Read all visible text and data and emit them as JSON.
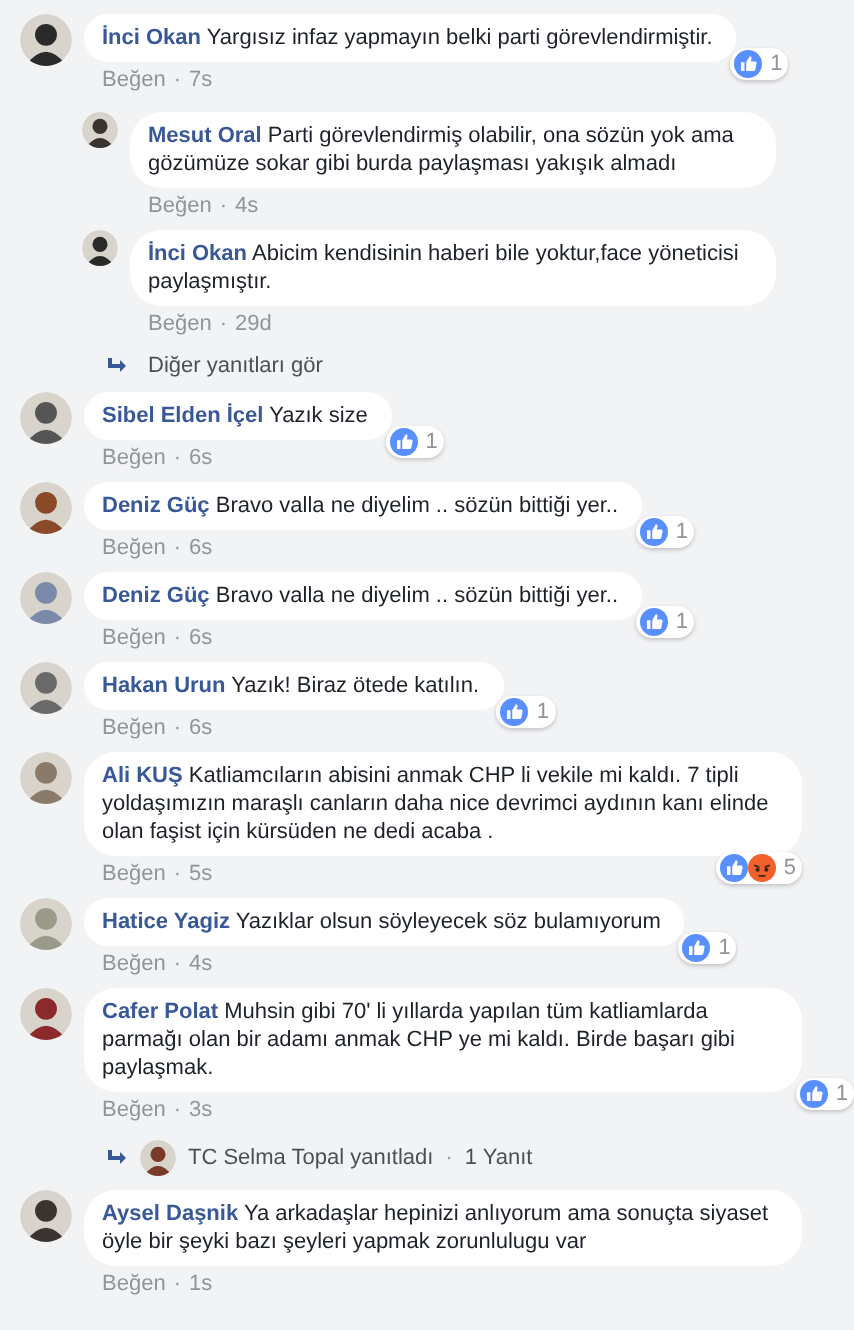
{
  "comments": [
    {
      "author": "İnci Okan",
      "text": "Yargısız infaz yapmayın belki parti görevlendirmiştir.",
      "like_label": "Beğen",
      "dot": "·",
      "time": "7s",
      "reactions": {
        "icons": [
          {
            "kind": "like"
          }
        ],
        "count": "1"
      },
      "replies": [
        {
          "author": "Mesut Oral",
          "text": "Parti görevlendirmiş olabilir, ona sözün yok ama gözümüze sokar gibi burda paylaşması yakışık almadı",
          "like_label": "Beğen",
          "dot": "·",
          "time": "4s"
        },
        {
          "author": "İnci Okan",
          "text": "Abicim kendisinin haberi bile yoktur,face yöneticisi paylaşmıştır.",
          "like_label": "Beğen",
          "dot": "·",
          "time": "29d"
        }
      ],
      "more_replies": "Diğer yanıtları gör"
    },
    {
      "author": "Sibel Elden İçel",
      "text": "Yazık size",
      "like_label": "Beğen",
      "dot": "·",
      "time": "6s",
      "reactions": {
        "icons": [
          {
            "kind": "like"
          }
        ],
        "count": "1"
      }
    },
    {
      "author": "Deniz Güç",
      "text": "Bravo valla ne diyelim .. sözün bittiği yer..",
      "like_label": "Beğen",
      "dot": "·",
      "time": "6s",
      "reactions": {
        "icons": [
          {
            "kind": "like"
          }
        ],
        "count": "1"
      }
    },
    {
      "author": "Deniz Güç",
      "text": "Bravo valla ne diyelim .. sözün bittiği yer..",
      "like_label": "Beğen",
      "dot": "·",
      "time": "6s",
      "reactions": {
        "icons": [
          {
            "kind": "like"
          }
        ],
        "count": "1"
      }
    },
    {
      "author": "Hakan Urun",
      "text": "Yazık! Biraz ötede katılın.",
      "like_label": "Beğen",
      "dot": "·",
      "time": "6s",
      "reactions": {
        "icons": [
          {
            "kind": "like"
          }
        ],
        "count": "1"
      }
    },
    {
      "author": "Ali KUŞ",
      "text": "Katliamcıların abisini anmak CHP li vekile mi kaldı. 7 tipli yoldaşımızın maraşlı canların daha nice devrimci aydının kanı elinde olan faşist için kürsüden ne dedi acaba .",
      "like_label": "Beğen",
      "dot": "·",
      "time": "5s",
      "reactions": {
        "icons": [
          {
            "kind": "like"
          },
          {
            "kind": "angry"
          }
        ],
        "count": "5"
      }
    },
    {
      "author": "Hatice Yagiz",
      "text": "Yazıklar olsun söyleyecek söz bulamıyorum",
      "like_label": "Beğen",
      "dot": "·",
      "time": "4s",
      "reactions": {
        "icons": [
          {
            "kind": "like"
          }
        ],
        "count": "1"
      }
    },
    {
      "author": "Cafer Polat",
      "text": "Muhsin gibi 70' li yıllarda yapılan tüm katliamlarda parmağı olan bir adamı anmak CHP ye mi kaldı. Birde başarı gibi paylaşmak.",
      "like_label": "Beğen",
      "dot": "·",
      "time": "3s",
      "reactions": {
        "icons": [
          {
            "kind": "like"
          }
        ],
        "count": "1"
      },
      "reply_summary": {
        "replier": "TC Selma Topal yanıtladı",
        "dot": "·",
        "count": "1 Yanıt"
      }
    },
    {
      "author": "Aysel Daşnik",
      "text": "Ya arkadaşlar hepinizi anlıyorum ama sonuçta siyaset öyle bir şeyki bazı şeyleri yapmak zorunlulugu var",
      "like_label": "Beğen",
      "dot": "·",
      "time": "1s"
    }
  ]
}
